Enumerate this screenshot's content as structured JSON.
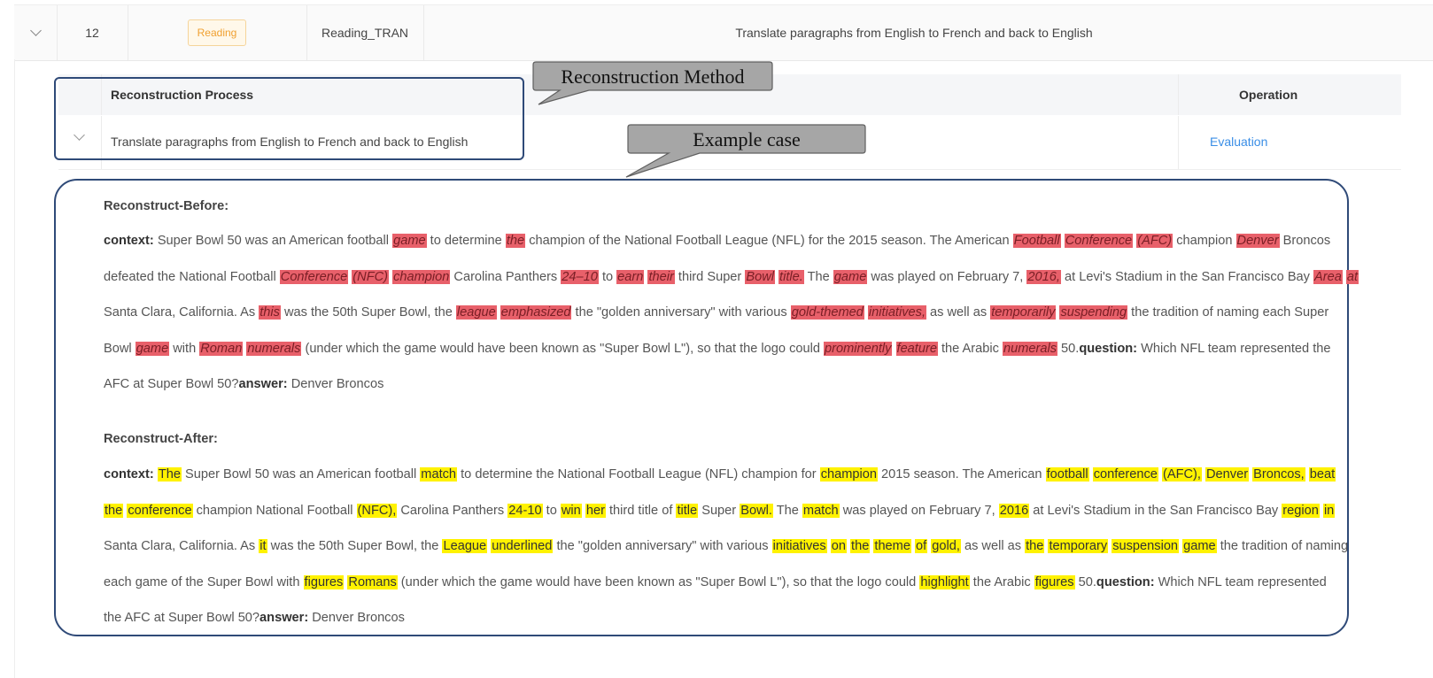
{
  "outer_row": {
    "index": "12",
    "tag": "Reading",
    "code": "Reading_TRAN",
    "description": "Translate paragraphs from English to French and back to English"
  },
  "inner_table": {
    "header_process": "Reconstruction Process",
    "header_operation": "Operation",
    "row_text": "Translate paragraphs from English to French and back to English",
    "row_action": "Evaluation"
  },
  "callouts": {
    "method": "Reconstruction Method",
    "example": "Example case"
  },
  "before": {
    "title": "Reconstruct-Before:",
    "lines": [
      [
        [
          "b",
          "context: "
        ],
        [
          "t",
          "Super Bowl 50 was an American football "
        ],
        [
          "r",
          "game"
        ],
        [
          "t",
          " to determine "
        ],
        [
          "r",
          "the"
        ],
        [
          "t",
          " champion of the National Football League (NFL) for the 2015 season. The American "
        ],
        [
          "r",
          "Football"
        ],
        [
          "t",
          " "
        ],
        [
          "r",
          "Conference"
        ],
        [
          "t",
          " "
        ],
        [
          "r",
          "(AFC)"
        ],
        [
          "t",
          " champion "
        ],
        [
          "r",
          "Denver"
        ],
        [
          "t",
          " Broncos"
        ]
      ],
      [
        [
          "t",
          "defeated the National Football "
        ],
        [
          "r",
          "Conference"
        ],
        [
          "t",
          " "
        ],
        [
          "r",
          "(NFC)"
        ],
        [
          "t",
          " "
        ],
        [
          "r",
          "champion"
        ],
        [
          "t",
          " Carolina Panthers "
        ],
        [
          "r",
          "24–10"
        ],
        [
          "t",
          " to "
        ],
        [
          "r",
          "earn"
        ],
        [
          "t",
          " "
        ],
        [
          "r",
          "their"
        ],
        [
          "t",
          " third Super "
        ],
        [
          "r",
          "Bowl"
        ],
        [
          "t",
          " "
        ],
        [
          "r",
          "title."
        ],
        [
          "t",
          " The "
        ],
        [
          "r",
          "game"
        ],
        [
          "t",
          " was played on February 7, "
        ],
        [
          "r",
          "2016,"
        ],
        [
          "t",
          " at Levi's Stadium in the San Francisco Bay "
        ],
        [
          "r",
          "Area"
        ],
        [
          "t",
          " "
        ],
        [
          "r",
          "at"
        ]
      ],
      [
        [
          "t",
          "Santa Clara, California. As "
        ],
        [
          "r",
          "this"
        ],
        [
          "t",
          " was the 50th Super Bowl, the "
        ],
        [
          "r",
          "league"
        ],
        [
          "t",
          " "
        ],
        [
          "r",
          "emphasized"
        ],
        [
          "t",
          " the \"golden anniversary\" with various "
        ],
        [
          "r",
          "gold-themed"
        ],
        [
          "t",
          " "
        ],
        [
          "r",
          "initiatives,"
        ],
        [
          "t",
          " as well as "
        ],
        [
          "r",
          "temporarily"
        ],
        [
          "t",
          " "
        ],
        [
          "r",
          "suspending"
        ],
        [
          "t",
          " the tradition of naming each Super"
        ]
      ],
      [
        [
          "t",
          "Bowl "
        ],
        [
          "r",
          "game"
        ],
        [
          "t",
          " with "
        ],
        [
          "r",
          "Roman"
        ],
        [
          "t",
          " "
        ],
        [
          "r",
          "numerals"
        ],
        [
          "t",
          " (under which the game would have been known as \"Super Bowl L\"), so that the logo could "
        ],
        [
          "r",
          "prominently"
        ],
        [
          "t",
          " "
        ],
        [
          "r",
          "feature"
        ],
        [
          "t",
          " the Arabic "
        ],
        [
          "r",
          "numerals"
        ],
        [
          "t",
          " 50."
        ],
        [
          "b",
          "question:"
        ],
        [
          "t",
          " Which NFL team represented the"
        ]
      ],
      [
        [
          "t",
          "AFC at Super Bowl 50?"
        ],
        [
          "b",
          "answer:"
        ],
        [
          "t",
          " Denver Broncos"
        ]
      ]
    ]
  },
  "after": {
    "title": "Reconstruct-After:",
    "lines": [
      [
        [
          "b",
          "context: "
        ],
        [
          "y",
          "The"
        ],
        [
          "t",
          " Super Bowl 50 was an American football "
        ],
        [
          "y",
          "match"
        ],
        [
          "t",
          " to determine the National Football League (NFL) champion for "
        ],
        [
          "y",
          "champion"
        ],
        [
          "t",
          " 2015 season. The American "
        ],
        [
          "y",
          "football"
        ],
        [
          "t",
          " "
        ],
        [
          "y",
          "conference"
        ],
        [
          "t",
          " "
        ],
        [
          "y",
          "(AFC),"
        ],
        [
          "t",
          " "
        ],
        [
          "y",
          "Denver"
        ],
        [
          "t",
          " "
        ],
        [
          "y",
          "Broncos,"
        ],
        [
          "t",
          " "
        ],
        [
          "y",
          "beat"
        ]
      ],
      [
        [
          "y",
          "the"
        ],
        [
          "t",
          " "
        ],
        [
          "y",
          "conference"
        ],
        [
          "t",
          " champion National Football "
        ],
        [
          "y",
          "(NFC),"
        ],
        [
          "t",
          " Carolina Panthers "
        ],
        [
          "y",
          "24-10"
        ],
        [
          "t",
          " to "
        ],
        [
          "y",
          "win"
        ],
        [
          "t",
          " "
        ],
        [
          "y",
          "her"
        ],
        [
          "t",
          " third title of "
        ],
        [
          "y",
          "title"
        ],
        [
          "t",
          " Super "
        ],
        [
          "y",
          "Bowl."
        ],
        [
          "t",
          " The "
        ],
        [
          "y",
          "match"
        ],
        [
          "t",
          " was played on February 7, "
        ],
        [
          "y",
          "2016"
        ],
        [
          "t",
          " at Levi's Stadium in the San Francisco Bay "
        ],
        [
          "y",
          "region"
        ],
        [
          "t",
          " "
        ],
        [
          "y",
          "in"
        ]
      ],
      [
        [
          "t",
          "Santa Clara, California. As "
        ],
        [
          "y",
          "it"
        ],
        [
          "t",
          " was the 50th Super Bowl, the "
        ],
        [
          "y",
          "League"
        ],
        [
          "t",
          " "
        ],
        [
          "y",
          "underlined"
        ],
        [
          "t",
          " the \"golden anniversary\" with various "
        ],
        [
          "y",
          "initiatives"
        ],
        [
          "t",
          " "
        ],
        [
          "y",
          "on"
        ],
        [
          "t",
          " "
        ],
        [
          "y",
          "the"
        ],
        [
          "t",
          " "
        ],
        [
          "y",
          "theme"
        ],
        [
          "t",
          " "
        ],
        [
          "y",
          "of"
        ],
        [
          "t",
          " "
        ],
        [
          "y",
          "gold,"
        ],
        [
          "t",
          " as well as "
        ],
        [
          "y",
          "the"
        ],
        [
          "t",
          " "
        ],
        [
          "y",
          "temporary"
        ],
        [
          "t",
          " "
        ],
        [
          "y",
          "suspension"
        ],
        [
          "t",
          " "
        ],
        [
          "y",
          "game"
        ],
        [
          "t",
          " the tradition of naming"
        ]
      ],
      [
        [
          "t",
          "each game of the Super Bowl with "
        ],
        [
          "y",
          "figures"
        ],
        [
          "t",
          " "
        ],
        [
          "y",
          "Romans"
        ],
        [
          "t",
          " (under which the game would have been known as \"Super Bowl L\"), so that the logo could "
        ],
        [
          "y",
          "highlight"
        ],
        [
          "t",
          " the Arabic "
        ],
        [
          "y",
          "figures"
        ],
        [
          "t",
          " 50."
        ],
        [
          "b",
          "question:"
        ],
        [
          "t",
          " Which NFL team represented"
        ]
      ],
      [
        [
          "t",
          "the AFC at Super Bowl 50?"
        ],
        [
          "b",
          "answer:"
        ],
        [
          "t",
          " Denver Broncos"
        ]
      ]
    ]
  },
  "colors": {
    "removed_highlight": "#e8606a",
    "added_highlight": "#fff200",
    "annotation_border": "#2f4a78",
    "callout_fill": "#a6a6a6",
    "link": "#3a8ee6",
    "tag": "#f0a030"
  }
}
